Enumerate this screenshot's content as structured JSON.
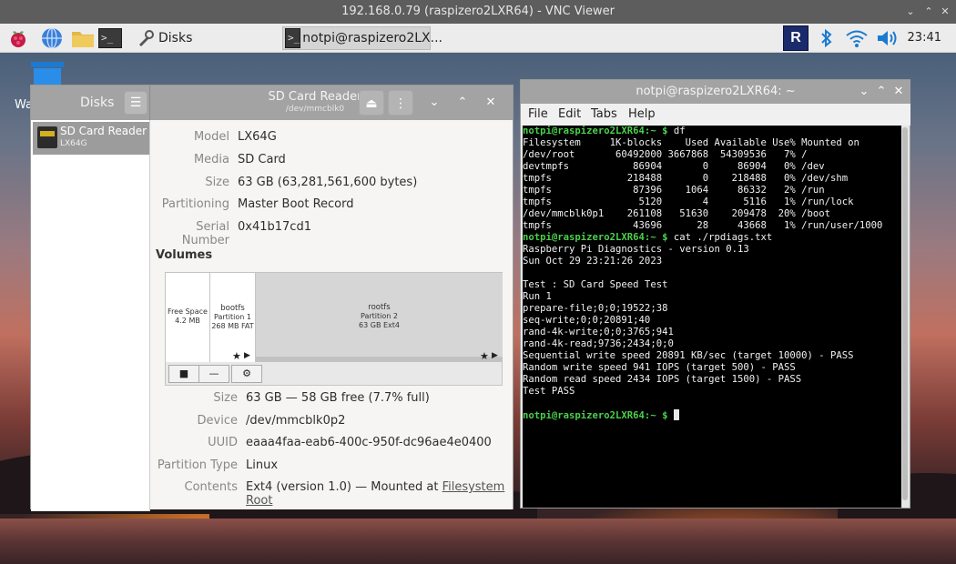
{
  "vnc": {
    "title": "192.168.0.79 (raspizero2LXR64) - VNC Viewer"
  },
  "taskbar": {
    "disks_label": "Disks",
    "terminal_label": "notpi@raspizero2LX...",
    "clock": "23:41"
  },
  "desktop": {
    "trash_label_fragment": "Wa"
  },
  "disks": {
    "header_title": "Disks",
    "device_title": "SD Card Reader",
    "device_subtitle": "/dev/mmcblk0",
    "sidebar": [
      {
        "name": "SD Card Reader",
        "sub": "LX64G"
      }
    ],
    "drive": [
      {
        "label": "Model",
        "value": "LX64G"
      },
      {
        "label": "Media",
        "value": "SD Card"
      },
      {
        "label": "Size",
        "value": "63 GB (63,281,561,600 bytes)"
      },
      {
        "label": "Partitioning",
        "value": "Master Boot Record"
      },
      {
        "label": "Serial Number",
        "value": "0x41b17cd1"
      }
    ],
    "volumes_heading": "Volumes",
    "segments": [
      {
        "l1": "Free Space",
        "l2": "4.2 MB",
        "l3": ""
      },
      {
        "l1": "bootfs",
        "l2": "Partition 1",
        "l3": "268 MB FAT"
      },
      {
        "l1": "rootfs",
        "l2": "Partition 2",
        "l3": "63 GB Ext4"
      }
    ],
    "partition": [
      {
        "label": "Size",
        "value": "63 GB — 58 GB free (7.7% full)"
      },
      {
        "label": "Device",
        "value": "/dev/mmcblk0p2"
      },
      {
        "label": "UUID",
        "value": "eaaa4faa-eab6-400c-950f-dc96ae4e0400"
      },
      {
        "label": "Partition Type",
        "value": "Linux"
      }
    ],
    "contents": {
      "label": "Contents",
      "prefix": "Ext4 (version 1.0) — Mounted at ",
      "link": "Filesystem Root"
    }
  },
  "terminal": {
    "title": "notpi@raspizero2LXR64: ~",
    "menu": [
      "File",
      "Edit",
      "Tabs",
      "Help"
    ],
    "prompt": "notpi@raspizero2LXR64:~ $",
    "lines": [
      {
        "p": true,
        "t": " df"
      },
      {
        "p": false,
        "t": "Filesystem     1K-blocks    Used Available Use% Mounted on"
      },
      {
        "p": false,
        "t": "/dev/root       60492000 3667868  54309536   7% /"
      },
      {
        "p": false,
        "t": "devtmpfs           86904       0     86904   0% /dev"
      },
      {
        "p": false,
        "t": "tmpfs             218488       0    218488   0% /dev/shm"
      },
      {
        "p": false,
        "t": "tmpfs              87396    1064     86332   2% /run"
      },
      {
        "p": false,
        "t": "tmpfs               5120       4      5116   1% /run/lock"
      },
      {
        "p": false,
        "t": "/dev/mmcblk0p1    261108   51630    209478  20% /boot"
      },
      {
        "p": false,
        "t": "tmpfs              43696      28     43668   1% /run/user/1000"
      },
      {
        "p": true,
        "t": " cat ./rpdiags.txt"
      },
      {
        "p": false,
        "t": "Raspberry Pi Diagnostics - version 0.13"
      },
      {
        "p": false,
        "t": "Sun Oct 29 23:21:26 2023"
      },
      {
        "p": false,
        "t": ""
      },
      {
        "p": false,
        "t": "Test : SD Card Speed Test"
      },
      {
        "p": false,
        "t": "Run 1"
      },
      {
        "p": false,
        "t": "prepare-file;0;0;19522;38"
      },
      {
        "p": false,
        "t": "seq-write;0;0;20891;40"
      },
      {
        "p": false,
        "t": "rand-4k-write;0;0;3765;941"
      },
      {
        "p": false,
        "t": "rand-4k-read;9736;2434;0;0"
      },
      {
        "p": false,
        "t": "Sequential write speed 20891 KB/sec (target 10000) - PASS"
      },
      {
        "p": false,
        "t": "Random write speed 941 IOPS (target 500) - PASS"
      },
      {
        "p": false,
        "t": "Random read speed 2434 IOPS (target 1500) - PASS"
      },
      {
        "p": false,
        "t": "Test PASS"
      },
      {
        "p": false,
        "t": ""
      },
      {
        "p": true,
        "t": " ",
        "cursor": true
      }
    ]
  }
}
